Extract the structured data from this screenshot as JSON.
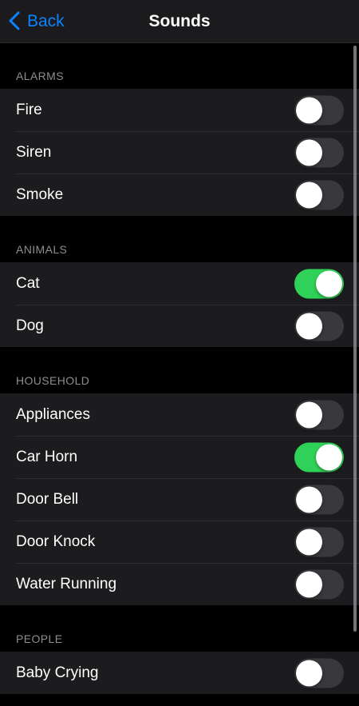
{
  "navbar": {
    "back_label": "Back",
    "title": "Sounds"
  },
  "colors": {
    "accent": "#0a84ff",
    "toggle_on": "#30d158",
    "toggle_off": "#39393d",
    "background": "#000000",
    "row_background": "#1c1c1e"
  },
  "sections": [
    {
      "header": "ALARMS",
      "items": [
        {
          "label": "Fire",
          "on": false
        },
        {
          "label": "Siren",
          "on": false
        },
        {
          "label": "Smoke",
          "on": false
        }
      ]
    },
    {
      "header": "ANIMALS",
      "items": [
        {
          "label": "Cat",
          "on": true
        },
        {
          "label": "Dog",
          "on": false
        }
      ]
    },
    {
      "header": "HOUSEHOLD",
      "items": [
        {
          "label": "Appliances",
          "on": false
        },
        {
          "label": "Car Horn",
          "on": true
        },
        {
          "label": "Door Bell",
          "on": false
        },
        {
          "label": "Door Knock",
          "on": false
        },
        {
          "label": "Water Running",
          "on": false
        }
      ]
    },
    {
      "header": "PEOPLE",
      "items": [
        {
          "label": "Baby Crying",
          "on": false
        }
      ]
    }
  ]
}
